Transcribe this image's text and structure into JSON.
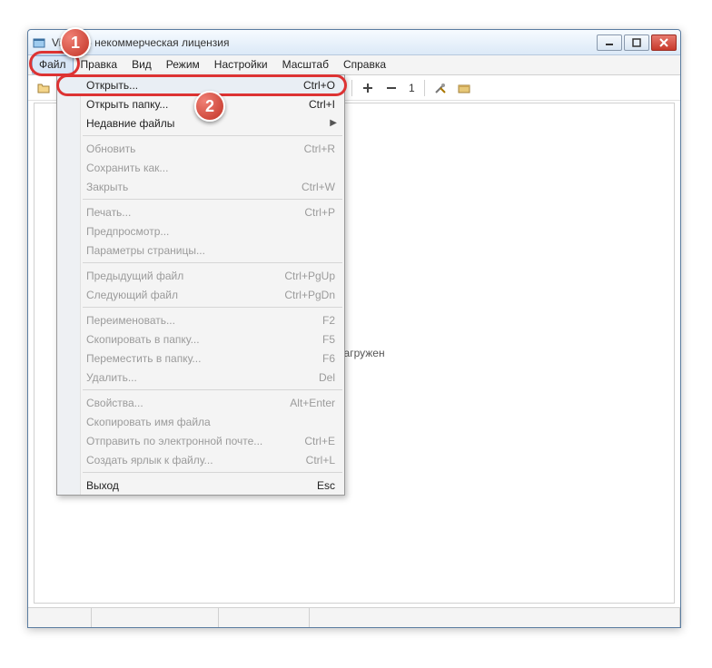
{
  "title": "Viewer - некоммерческая лицензия",
  "menubar": [
    "Файл",
    "Правка",
    "Вид",
    "Режим",
    "Настройки",
    "Масштаб",
    "Справка"
  ],
  "toolbar_num": "1",
  "content_text": "не загружен",
  "dropdown": [
    {
      "type": "item",
      "label": "Открыть...",
      "shortcut": "Ctrl+O",
      "highlight": true
    },
    {
      "type": "item",
      "label": "Открыть папку...",
      "shortcut": "Ctrl+I"
    },
    {
      "type": "item",
      "label": "Недавние файлы",
      "submenu": true
    },
    {
      "type": "sep"
    },
    {
      "type": "item",
      "label": "Обновить",
      "shortcut": "Ctrl+R",
      "disabled": true
    },
    {
      "type": "item",
      "label": "Сохранить как...",
      "disabled": true
    },
    {
      "type": "item",
      "label": "Закрыть",
      "shortcut": "Ctrl+W",
      "disabled": true
    },
    {
      "type": "sep"
    },
    {
      "type": "item",
      "label": "Печать...",
      "shortcut": "Ctrl+P",
      "disabled": true
    },
    {
      "type": "item",
      "label": "Предпросмотр...",
      "disabled": true
    },
    {
      "type": "item",
      "label": "Параметры страницы...",
      "disabled": true
    },
    {
      "type": "sep"
    },
    {
      "type": "item",
      "label": "Предыдущий файл",
      "shortcut": "Ctrl+PgUp",
      "disabled": true
    },
    {
      "type": "item",
      "label": "Следующий файл",
      "shortcut": "Ctrl+PgDn",
      "disabled": true
    },
    {
      "type": "sep"
    },
    {
      "type": "item",
      "label": "Переименовать...",
      "shortcut": "F2",
      "disabled": true
    },
    {
      "type": "item",
      "label": "Скопировать в папку...",
      "shortcut": "F5",
      "disabled": true
    },
    {
      "type": "item",
      "label": "Переместить в папку...",
      "shortcut": "F6",
      "disabled": true
    },
    {
      "type": "item",
      "label": "Удалить...",
      "shortcut": "Del",
      "disabled": true
    },
    {
      "type": "sep"
    },
    {
      "type": "item",
      "label": "Свойства...",
      "shortcut": "Alt+Enter",
      "disabled": true
    },
    {
      "type": "item",
      "label": "Скопировать имя файла",
      "disabled": true
    },
    {
      "type": "item",
      "label": "Отправить по электронной почте...",
      "shortcut": "Ctrl+E",
      "disabled": true
    },
    {
      "type": "item",
      "label": "Создать ярлык к файлу...",
      "shortcut": "Ctrl+L",
      "disabled": true
    },
    {
      "type": "sep"
    },
    {
      "type": "item",
      "label": "Выход",
      "shortcut": "Esc"
    }
  ],
  "callouts": {
    "b1": "1",
    "b2": "2"
  }
}
